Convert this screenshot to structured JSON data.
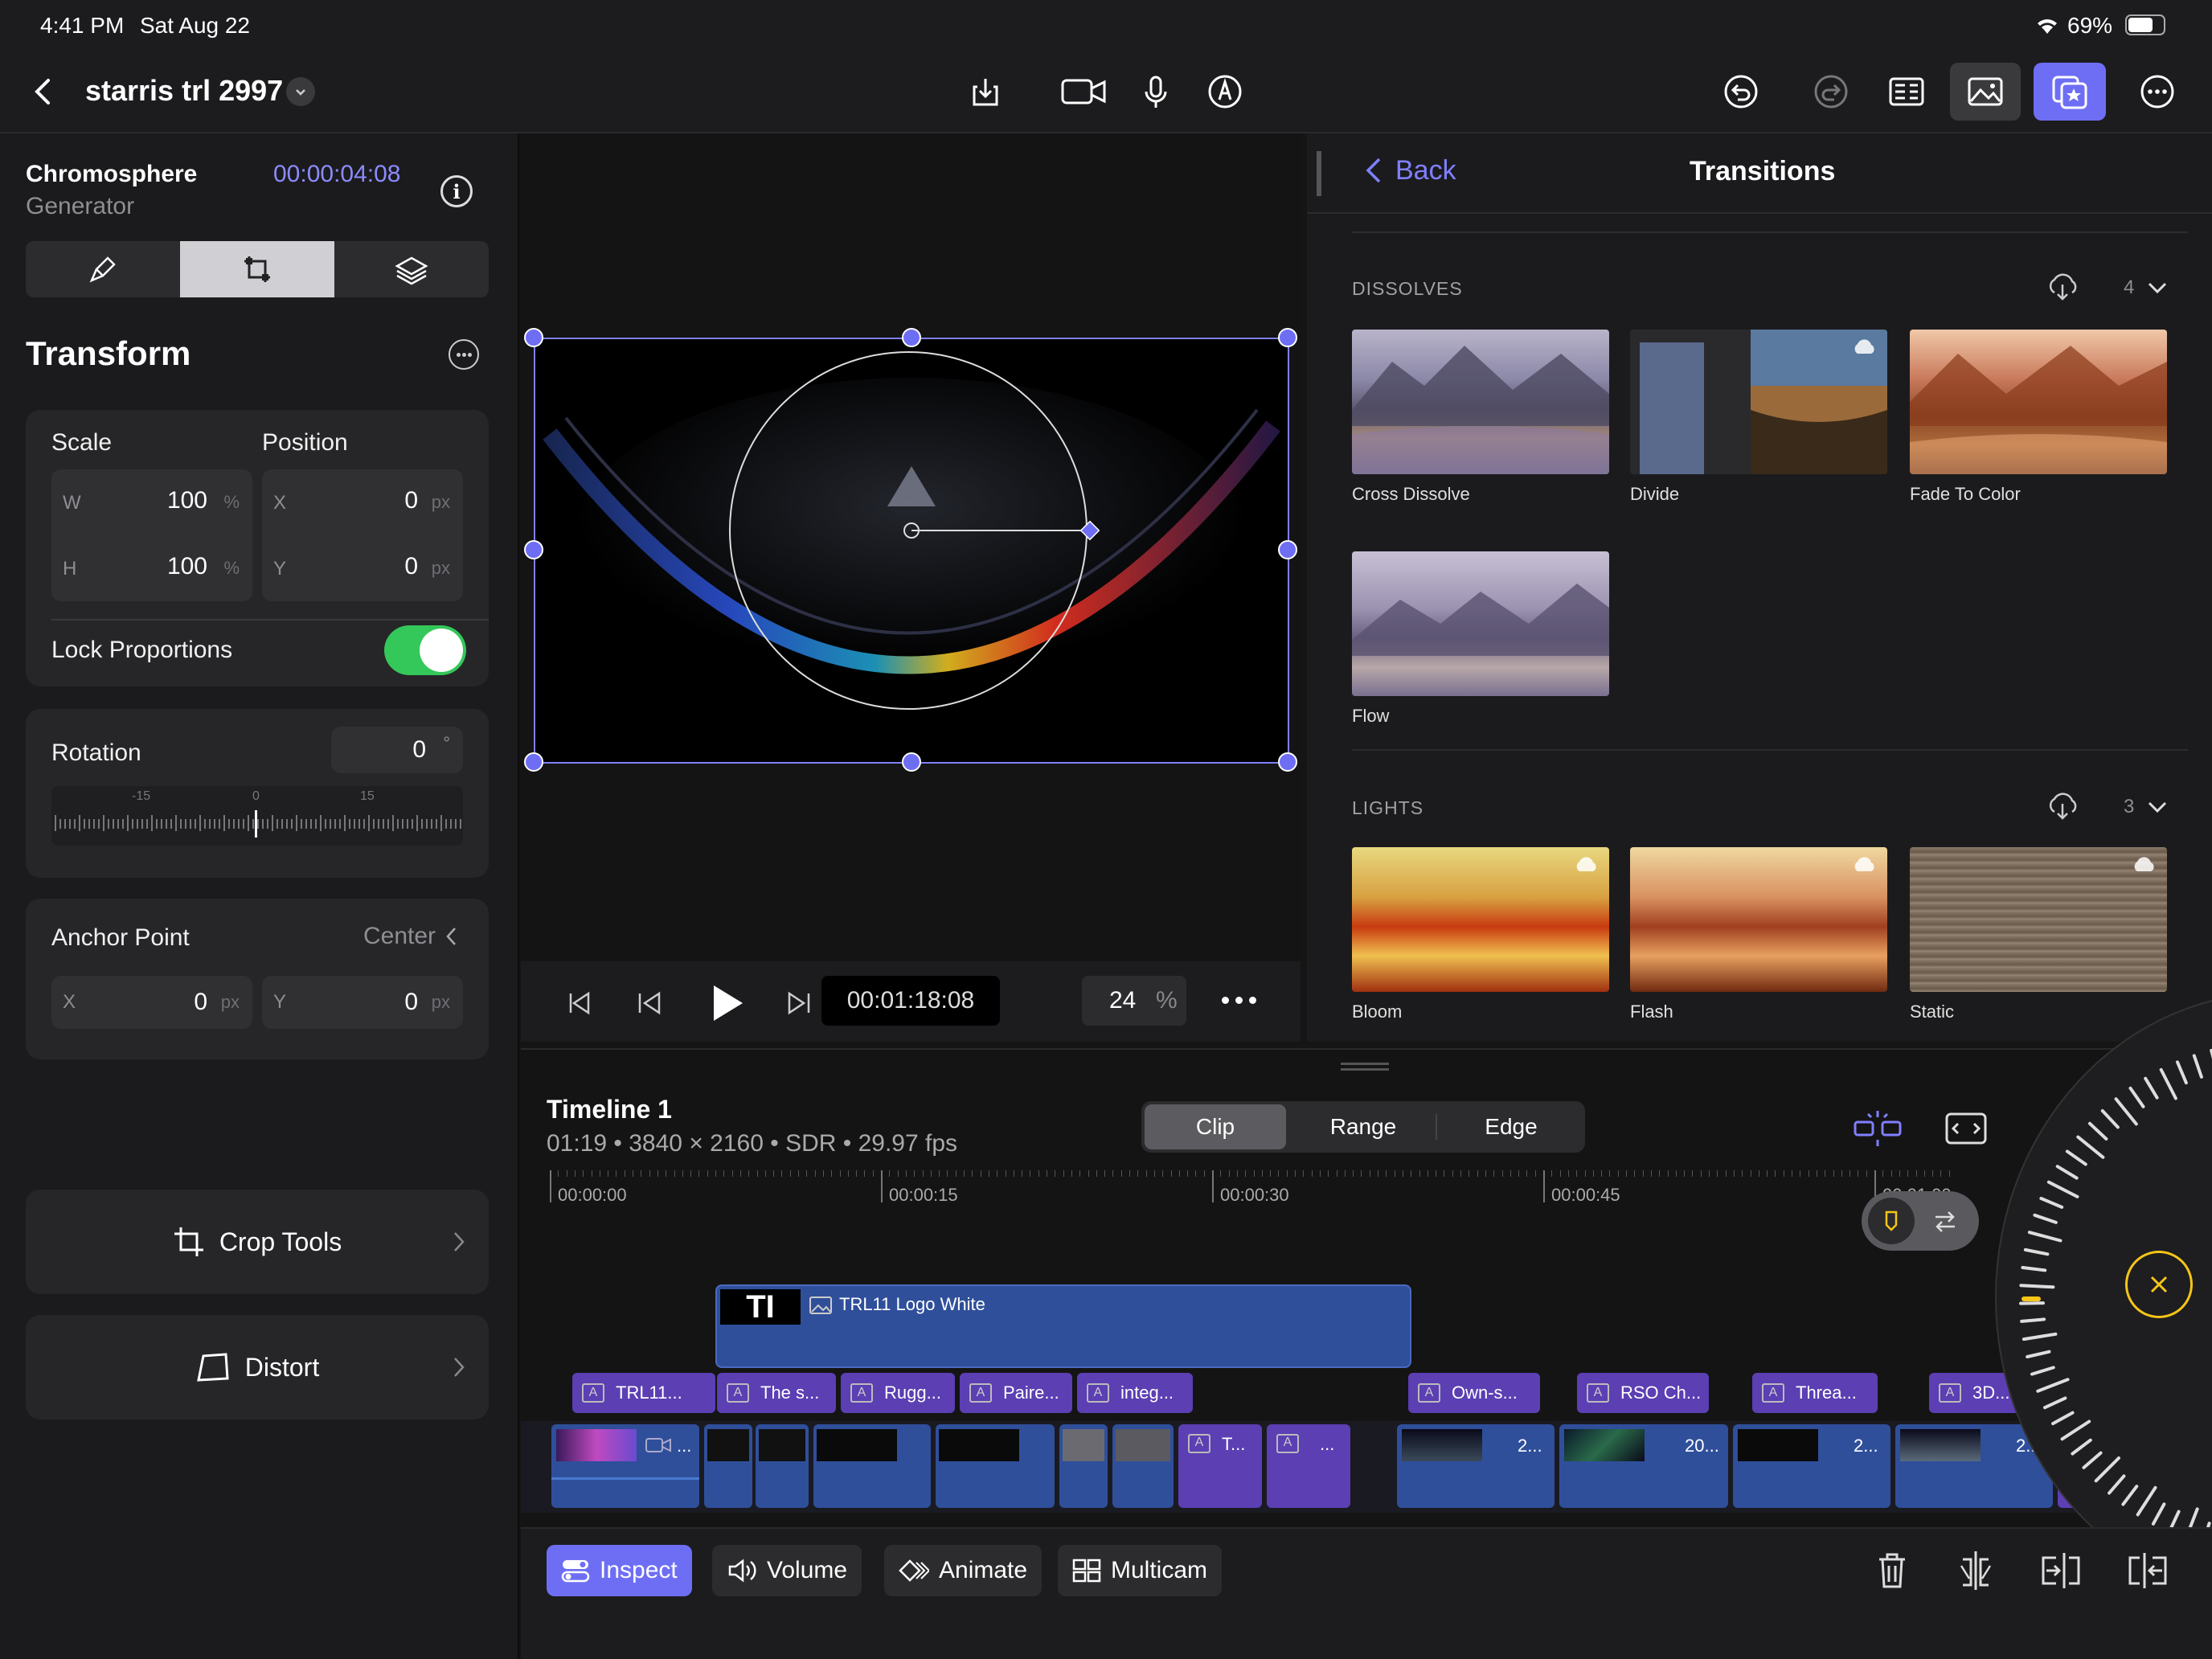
{
  "status": {
    "time": "4:41 PM",
    "date": "Sat Aug 22",
    "battery": "69%"
  },
  "project": {
    "title": "starris trl 2997"
  },
  "toolbar": {
    "icons": [
      "back-chevron-icon",
      "export-icon",
      "camera-icon",
      "microphone-icon",
      "pencil-icon",
      "undo-icon",
      "redo-icon",
      "inspector-icon",
      "photos-icon",
      "browser-star-icon",
      "more-icon"
    ]
  },
  "inspector": {
    "clip_name": "Chromosphere",
    "clip_type": "Generator",
    "timecode": "00:00:04:08",
    "tabs": [
      "paintbrush-icon",
      "transform-icon",
      "layers-icon"
    ],
    "section_title": "Transform",
    "scale_label": "Scale",
    "position_label": "Position",
    "scale_w_key": "W",
    "scale_w": "100",
    "scale_h_key": "H",
    "scale_h": "100",
    "pct": "%",
    "pos_x_key": "X",
    "pos_x": "0",
    "pos_y_key": "Y",
    "pos_y": "0",
    "px": "px",
    "lock_label": "Lock Proportions",
    "lock_on": true,
    "rotation_label": "Rotation",
    "rotation_value": "0",
    "rotation_unit": "°",
    "dial_ticks": [
      "-15",
      "0",
      "15"
    ],
    "anchor_label": "Anchor Point",
    "anchor_value": "Center",
    "anchor_x_key": "X",
    "anchor_x": "0",
    "anchor_y_key": "Y",
    "anchor_y": "0",
    "crop_label": "Crop Tools",
    "distort_label": "Distort"
  },
  "viewer": {
    "timecode": "00:01:18:08",
    "zoom": "24",
    "zoom_unit": "%"
  },
  "browser": {
    "back_label": "Back",
    "title": "Transitions",
    "sections": [
      {
        "name": "DISSOLVES",
        "count": "4",
        "items": [
          "Cross Dissolve",
          "Divide",
          "Fade To Color",
          "Flow"
        ]
      },
      {
        "name": "LIGHTS",
        "count": "3",
        "items": [
          "Bloom",
          "Flash",
          "Static"
        ]
      }
    ]
  },
  "timeline": {
    "name": "Timeline 1",
    "info": "01:19 • 3840 × 2160 • SDR • 29.97 fps",
    "modes": [
      "Clip",
      "Range",
      "Edge"
    ],
    "active_mode": "Clip",
    "ruler": [
      "00:00:00",
      "00:00:15",
      "00:00:30",
      "00:00:45",
      "00:01:00"
    ],
    "title_clip": "TRL11 Logo White",
    "title_clip_prefix": "TI",
    "connected": [
      "TRL11...",
      "The s...",
      "Rugg...",
      "Paire...",
      "integ...",
      "Own-s...",
      "RSO Ch...",
      "Threa...",
      "3D..."
    ],
    "primary_labels": [
      "...",
      "T...",
      "...",
      "2...",
      "20...",
      "2...",
      "2..."
    ]
  },
  "bottom": {
    "inspect": "Inspect",
    "volume": "Volume",
    "animate": "Animate",
    "multicam": "Multicam"
  },
  "colors": {
    "accent": "#6e6ef5",
    "toggle": "#34c759",
    "jog": "#f5c518"
  }
}
